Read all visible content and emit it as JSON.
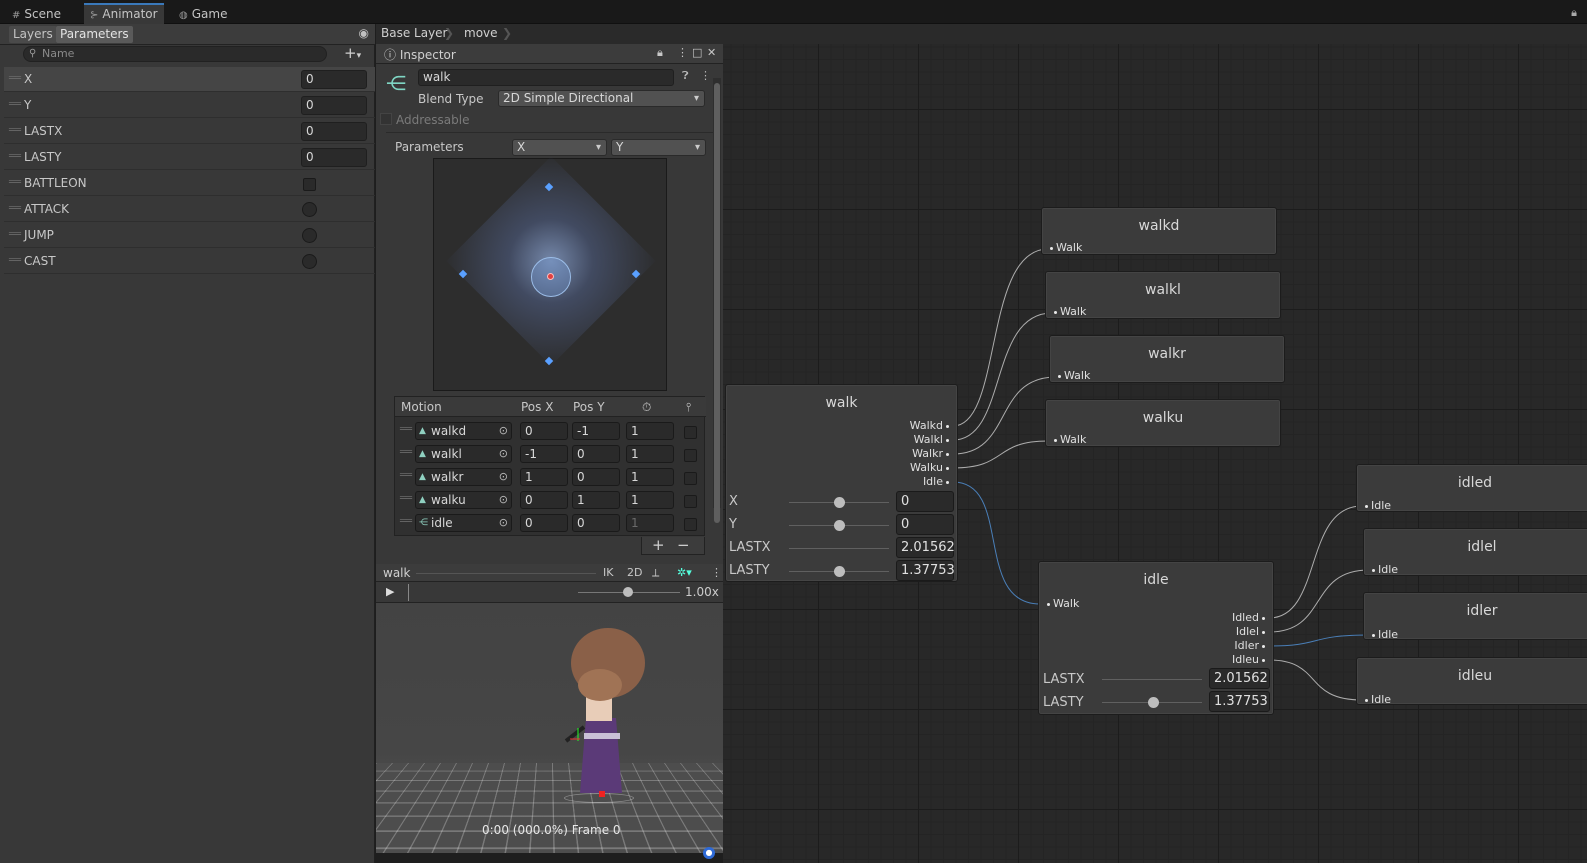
{
  "tabs": [
    {
      "label": "Scene",
      "icon": "grid-icon"
    },
    {
      "label": "Animator",
      "icon": "animator-icon"
    },
    {
      "label": "Game",
      "icon": "gamepad-icon"
    }
  ],
  "left_panel": {
    "layers_label": "Layers",
    "parameters_label": "Parameters",
    "search_placeholder": "Name",
    "params": [
      {
        "name": "X",
        "type": "float",
        "value": "0"
      },
      {
        "name": "Y",
        "type": "float",
        "value": "0"
      },
      {
        "name": "LASTX",
        "type": "float",
        "value": "0"
      },
      {
        "name": "LASTY",
        "type": "float",
        "value": "0"
      },
      {
        "name": "BATTLEON",
        "type": "bool"
      },
      {
        "name": "ATTACK",
        "type": "trigger"
      },
      {
        "name": "JUMP",
        "type": "trigger"
      },
      {
        "name": "CAST",
        "type": "trigger"
      }
    ]
  },
  "breadcrumb": [
    "Base Layer",
    "move"
  ],
  "inspector": {
    "title": "Inspector",
    "object_name": "walk",
    "blend_type_label": "Blend Type",
    "blend_type_value": "2D Simple Directional",
    "addressable_label": "Addressable",
    "parameters_label": "Parameters",
    "param_x": "X",
    "param_y": "Y",
    "motion_headers": {
      "motion": "Motion",
      "pos_x": "Pos X",
      "pos_y": "Pos Y"
    },
    "motions": [
      {
        "name": "walkd",
        "pos_x": "0",
        "pos_y": "-1",
        "speed": "1"
      },
      {
        "name": "walkl",
        "pos_x": "-1",
        "pos_y": "0",
        "speed": "1"
      },
      {
        "name": "walkr",
        "pos_x": "1",
        "pos_y": "0",
        "speed": "1"
      },
      {
        "name": "walku",
        "pos_x": "0",
        "pos_y": "1",
        "speed": "1"
      },
      {
        "name": "idle",
        "pos_x": "0",
        "pos_y": "0",
        "speed": "1"
      }
    ],
    "add_label": "+",
    "remove_label": "−"
  },
  "preview": {
    "clip_name": "walk",
    "ik_label": "IK",
    "mode_label": "2D",
    "speed": "1.00x",
    "frame_text": "0:00 (000.0%) Frame 0"
  },
  "graph": {
    "walk_node": {
      "title": "walk",
      "outputs": [
        "Walkd",
        "Walkl",
        "Walkr",
        "Walku",
        "Idle"
      ],
      "params": [
        {
          "name": "X",
          "value": "0"
        },
        {
          "name": "Y",
          "value": "0"
        },
        {
          "name": "LASTX",
          "value": "2.01562"
        },
        {
          "name": "LASTY",
          "value": "1.37753"
        }
      ]
    },
    "idle_node": {
      "title": "idle",
      "input": "Walk",
      "outputs": [
        "Idled",
        "Idlel",
        "Idler",
        "Idleu"
      ],
      "params": [
        {
          "name": "LASTX",
          "value": "2.01562"
        },
        {
          "name": "LASTY",
          "value": "1.37753"
        }
      ]
    },
    "walk_targets": [
      {
        "title": "walkd",
        "input": "Walk"
      },
      {
        "title": "walkl",
        "input": "Walk"
      },
      {
        "title": "walkr",
        "input": "Walk"
      },
      {
        "title": "walku",
        "input": "Walk"
      }
    ],
    "idle_targets": [
      {
        "title": "idled",
        "input": "Idle"
      },
      {
        "title": "idlel",
        "input": "Idle"
      },
      {
        "title": "idler",
        "input": "Idle"
      },
      {
        "title": "idleu",
        "input": "Idle"
      }
    ]
  }
}
